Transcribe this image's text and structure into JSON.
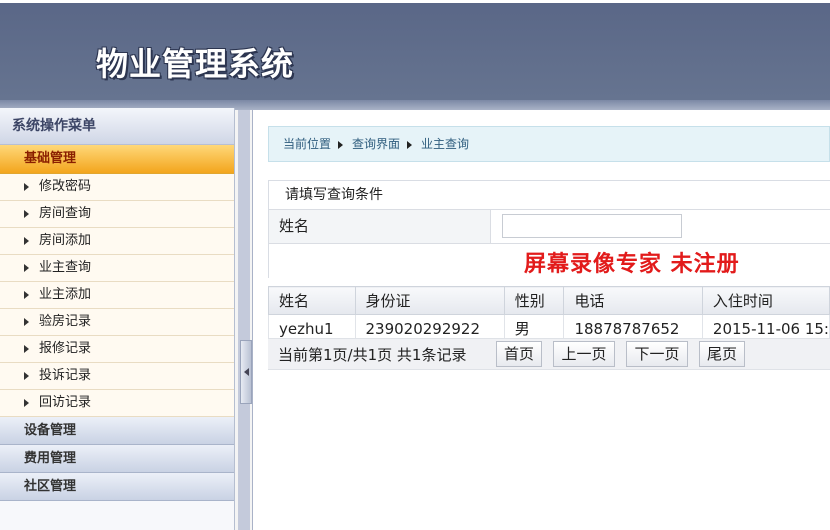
{
  "header": {
    "title": "物业管理系统"
  },
  "sidebar": {
    "title": "系统操作菜单",
    "active_group": "基础管理",
    "items": [
      {
        "label": "修改密码"
      },
      {
        "label": "房间查询"
      },
      {
        "label": "房间添加"
      },
      {
        "label": "业主查询"
      },
      {
        "label": "业主添加"
      },
      {
        "label": "验房记录"
      },
      {
        "label": "报修记录"
      },
      {
        "label": "投诉记录"
      },
      {
        "label": "回访记录"
      }
    ],
    "groups": [
      {
        "label": "设备管理"
      },
      {
        "label": "费用管理"
      },
      {
        "label": "社区管理"
      }
    ]
  },
  "breadcrumb": [
    "当前位置",
    "查询界面",
    "业主查询"
  ],
  "query": {
    "title": "请填写查询条件",
    "name_label": "姓名",
    "name_value": ""
  },
  "watermark": "屏幕录像专家  未注册",
  "table": {
    "headers": [
      "姓名",
      "身份证",
      "性别",
      "电话",
      "入住时间"
    ],
    "rows": [
      [
        "yezhu1",
        "239020292922",
        "男",
        "18878787652",
        "2015-11-06 15:"
      ]
    ]
  },
  "pager": {
    "info": "当前第1页/共1页  共1条记录",
    "first": "首页",
    "prev": "上一页",
    "next": "下一页",
    "last": "尾页"
  },
  "colors": {
    "header_bg": "#5f6c8a",
    "active_menu": "#f3a51d",
    "watermark": "#e21b1b",
    "breadcrumb_bg": "#e6f3f8"
  }
}
